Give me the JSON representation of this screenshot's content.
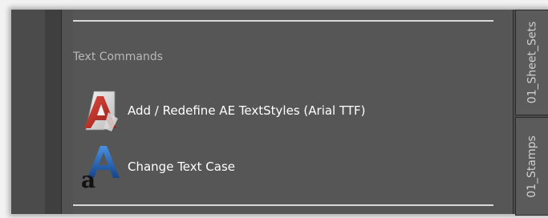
{
  "palette": {
    "section_title": "Text Commands",
    "commands": [
      {
        "label": "Add / Redefine AE TextStyles (Arial TTF)",
        "icon": "textstyle-a-icon"
      },
      {
        "label": "Change Text Case",
        "icon": "text-case-aa-icon"
      }
    ]
  },
  "tabs": [
    {
      "label": "01_Sheet_Sets"
    },
    {
      "label": "01_Stamps"
    }
  ],
  "colors": {
    "panel": "#565656",
    "text": "#ffffff",
    "section_title": "#b8b8b8",
    "accent_red": "#c0302c",
    "accent_blue": "#1f5fae"
  }
}
